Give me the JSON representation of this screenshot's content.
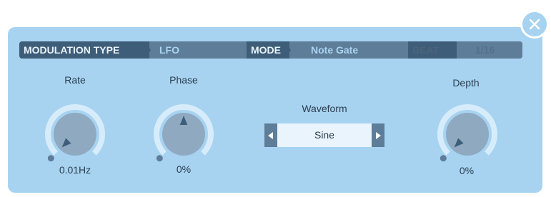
{
  "modulation_bar": {
    "type_label": "MODULATION TYPE",
    "type_value": "LFO",
    "mode_label": "MODE",
    "mode_value": "Note Gate",
    "beat_label": "BEAT",
    "beat_value": "1/16"
  },
  "controls": {
    "rate": {
      "label": "Rate",
      "value": "0.01Hz",
      "level": 0.0
    },
    "phase": {
      "label": "Phase",
      "value": "0%",
      "level": 0.5
    },
    "depth": {
      "label": "Depth",
      "value": "0%",
      "level": 0.0
    }
  },
  "waveform": {
    "label": "Waveform",
    "value": "Sine",
    "prev_icon": "triangle-left-icon",
    "next_icon": "triangle-right-icon"
  },
  "colors": {
    "panel_bg": "#a7d3f1",
    "bar_dark": "#3e5d78",
    "bar_light": "#5e7d99",
    "knob_face": "#8fa9c0",
    "knob_track": "#d7ecfa",
    "pointer": "#3e5d78"
  },
  "icons": {
    "close": "close-icon"
  }
}
